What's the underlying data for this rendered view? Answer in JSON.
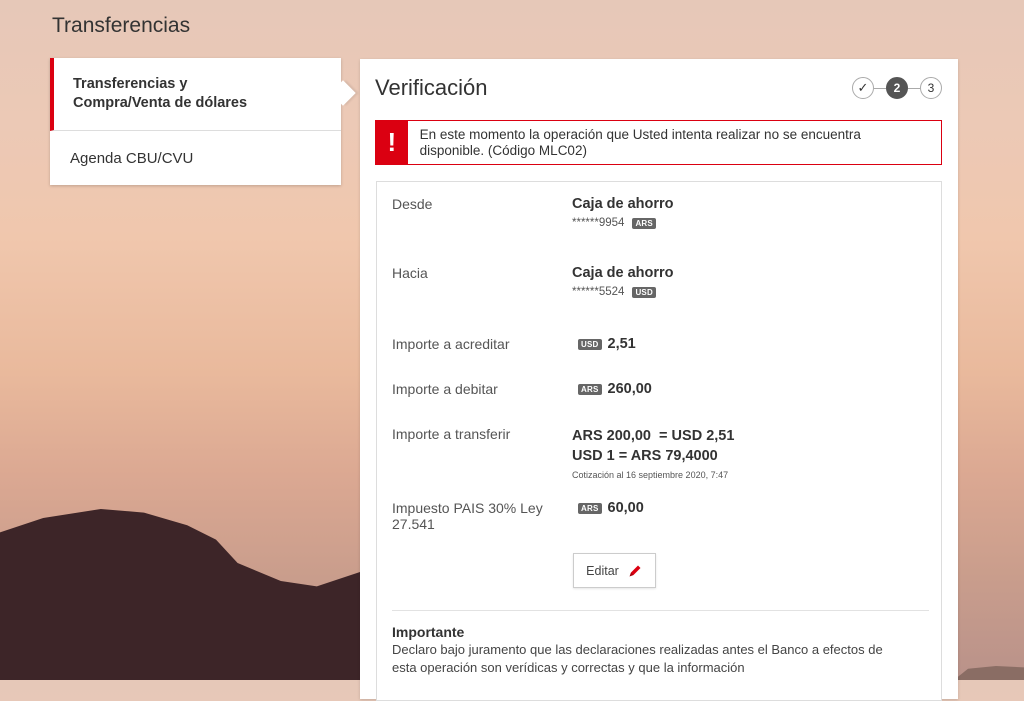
{
  "page_title": "Transferencias",
  "sidemenu": {
    "items": [
      {
        "label_line1": "Transferencias y",
        "label_line2": "Compra/Venta de dólares",
        "active": true
      },
      {
        "label": "Agenda CBU/CVU",
        "active": false
      }
    ]
  },
  "panel": {
    "title": "Verificación",
    "steps": {
      "step1": "✓",
      "step2": "2",
      "step3": "3",
      "current": 2
    }
  },
  "alert": {
    "icon": "!",
    "message": "En este momento la operación que Usted intenta realizar no se encuentra disponible. (Código MLC02)"
  },
  "detail": {
    "desde": {
      "label": "Desde",
      "account_type": "Caja de ahorro",
      "account_number": "******9954",
      "currency": "ARS"
    },
    "hacia": {
      "label": "Hacia",
      "account_type": "Caja de ahorro",
      "account_number": "******5524",
      "currency": "USD"
    },
    "importe_acreditar": {
      "label": "Importe a acreditar",
      "currency": "USD",
      "amount": "2,51"
    },
    "importe_debitar": {
      "label": "Importe a debitar",
      "currency": "ARS",
      "amount": "260,00"
    },
    "importe_transferir": {
      "label": "Importe a transferir",
      "line1": "ARS 200,00  = USD 2,51",
      "line2": "USD 1 = ARS 79,4000",
      "quote": "Cotización al 16 septiembre 2020, 7:47"
    },
    "impuesto": {
      "label": "Impuesto PAIS 30% Ley 27.541",
      "currency": "ARS",
      "amount": "60,00"
    },
    "edit_label": "Editar"
  },
  "important": {
    "title": "Importante",
    "text": "Declaro bajo juramento que las declaraciones realizadas antes el Banco a efectos de esta operación son verídicas y correctas y que la información"
  },
  "colors": {
    "accent_red": "#db0011",
    "badge_gray": "#666666"
  }
}
